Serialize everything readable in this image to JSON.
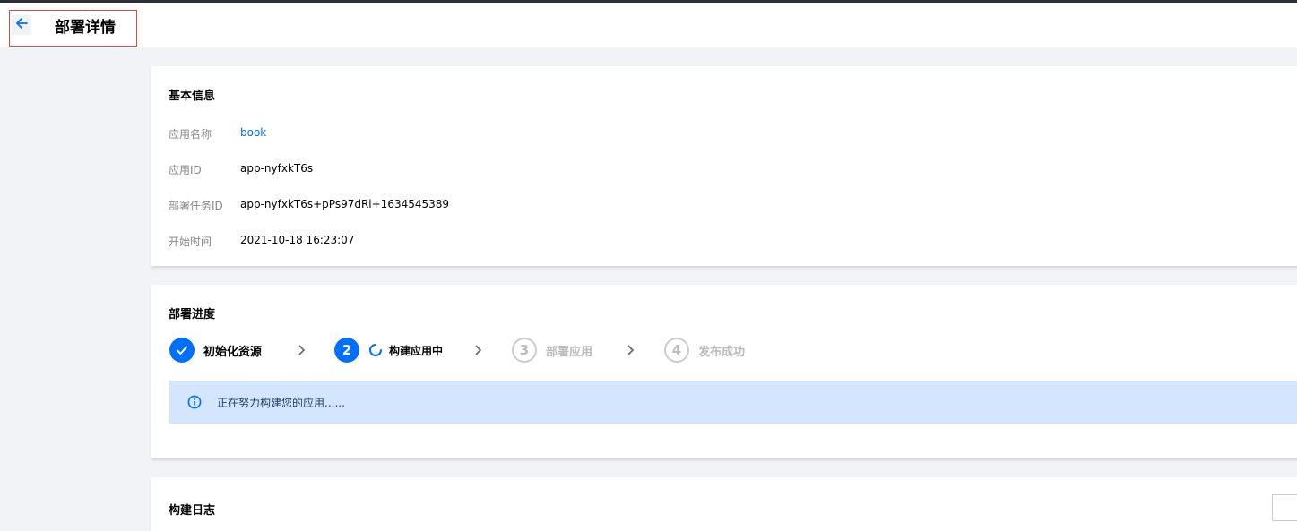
{
  "header": {
    "title": "部署详情",
    "back_icon": "arrow-left-icon"
  },
  "basic_info": {
    "title": "基本信息",
    "rows": [
      {
        "label": "应用名称",
        "value": "book"
      },
      {
        "label": "应用ID",
        "value": "app-nyfxkT6s"
      },
      {
        "label": "部署任务ID",
        "value": "app-nyfxkT6s+pPs97dRi+1634545389"
      },
      {
        "label": "开始时间",
        "value": "2021-10-18 16:23:07"
      }
    ]
  },
  "progress": {
    "title": "部署进度",
    "steps": [
      {
        "number": "",
        "label": "初始化资源",
        "state": "done"
      },
      {
        "number": "2",
        "label": "构建应用中",
        "state": "active"
      },
      {
        "number": "3",
        "label": "部署应用",
        "state": "pending"
      },
      {
        "number": "4",
        "label": "发布成功",
        "state": "pending"
      }
    ],
    "notice": "正在努力构建您的应用......"
  },
  "log": {
    "title": "构建日志"
  },
  "colors": {
    "accent": "#006eff",
    "notice_bg": "#d4e6fd",
    "page_bg": "#f2f3f6"
  }
}
